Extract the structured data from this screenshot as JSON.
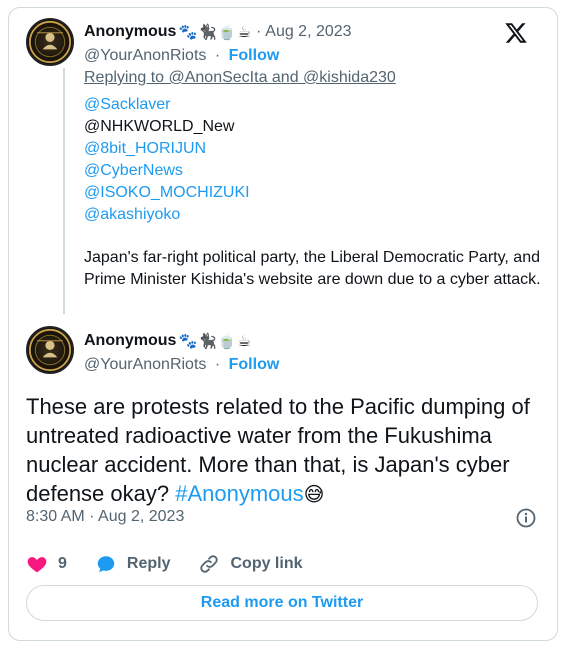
{
  "quoted_tweet": {
    "author_name": "Anonymous",
    "author_emojis": "🐾🐈‍⬛🍵☕",
    "date": "Aug 2, 2023",
    "handle": "@YourAnonRiots",
    "follow_label": "Follow",
    "replying_to": "Replying to @AnonSecIta and @kishida230",
    "mentions": [
      "@Sacklaver",
      "@NHKWORLD_New",
      "@8bit_HORIJUN",
      "@CyberNews",
      "@ISOKO_MOCHIZUKI",
      "@akashiyoko"
    ],
    "text": "Japan's far-right political party, the Liberal Democratic Party, and Prime Minister Kishida's website are down due to a cyber attack."
  },
  "main_tweet": {
    "author_name": "Anonymous",
    "author_emojis": "🐾🐈‍⬛🍵☕",
    "handle": "@YourAnonRiots",
    "follow_label": "Follow",
    "text": "These are protests related to the Pacific dumping of untreated radioactive water from the Fukushima nuclear accident. More than that, is Japan's cyber defense okay? ",
    "hashtag": "#Anonymous",
    "trailing_emoji": "😅",
    "timestamp": "8:30 AM · Aug 2, 2023"
  },
  "actions": {
    "like_count": "9",
    "reply_label": "Reply",
    "copy_link_label": "Copy link"
  },
  "read_more_label": "Read more on Twitter",
  "icons": {
    "brand": "x-logo-icon",
    "like": "heart-icon",
    "reply": "speech-bubble-icon",
    "copy": "link-icon",
    "info": "info-icon"
  },
  "colors": {
    "accent": "#1d9bf0",
    "heart": "#f91880",
    "muted": "#536471",
    "border": "#cfd9de"
  }
}
